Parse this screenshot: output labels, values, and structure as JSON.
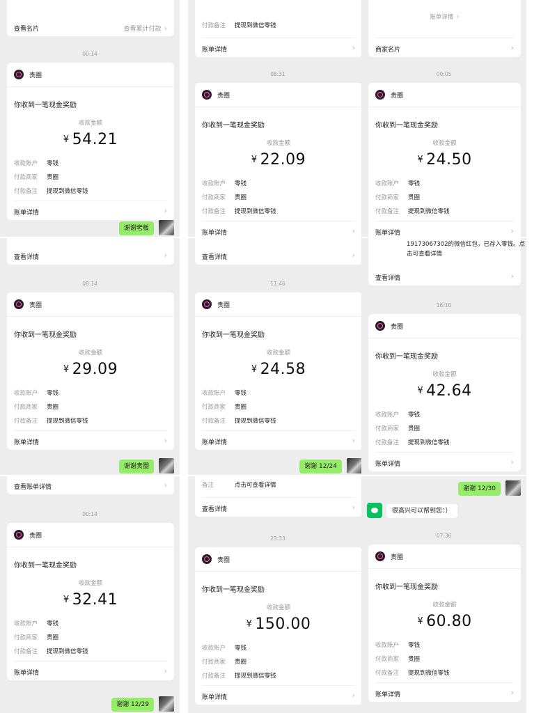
{
  "brand": "贵圈",
  "card_title": "你收到一笔现金奖励",
  "amount_label": "收款金额",
  "currency": "¥",
  "labels": {
    "account": "收款账户",
    "merchant": "付款商家",
    "note": "付款备注"
  },
  "values": {
    "account": "零钱",
    "merchant": "贵圈",
    "note": "提现到微信零钱"
  },
  "detail_label": "账单详情",
  "chevron": "›",
  "panels": [
    {
      "top": {
        "left": "查看名片",
        "right": "查看累计付款"
      },
      "time": "00:14",
      "amount": "54.21",
      "reply": "谢谢老板"
    },
    {
      "top": {
        "left": "账单详情",
        "pre_label": "付款备注",
        "pre_value": "提现到微信零钱"
      },
      "time": "08:31",
      "amount": "22.09"
    },
    {
      "top": {
        "left": "商家名片",
        "pre_center": "账单详情"
      },
      "time": "00:05",
      "amount": "24.50"
    },
    {
      "top": {
        "left": "查看详情"
      },
      "time": "08:14",
      "amount": "29.09",
      "reply": "谢谢贵圈"
    },
    {
      "top": {
        "left": "查看详情"
      },
      "time": "11:46",
      "amount": "24.58",
      "reply": "谢谢 12/24"
    },
    {
      "top": {
        "left": "查看详情",
        "red_packet": "19173067302的微信红包，已存入零钱。点击可查看详情"
      },
      "time": "16:10",
      "amount": "42.64"
    },
    {
      "top": {
        "left": "查看账单详情"
      },
      "time": "00:14",
      "amount": "32.41",
      "reply": "谢谢 12/29"
    },
    {
      "top": {
        "left": "查看详情",
        "pre_label": "备注",
        "pre_value": "点击可查看详情"
      },
      "time": "23:33",
      "amount": "150.00"
    },
    {
      "top": {
        "reply_top": "谢谢 12/30",
        "bot_reply": "很高兴可以帮到您：）"
      },
      "time": "07:36",
      "amount": "60.80"
    }
  ]
}
